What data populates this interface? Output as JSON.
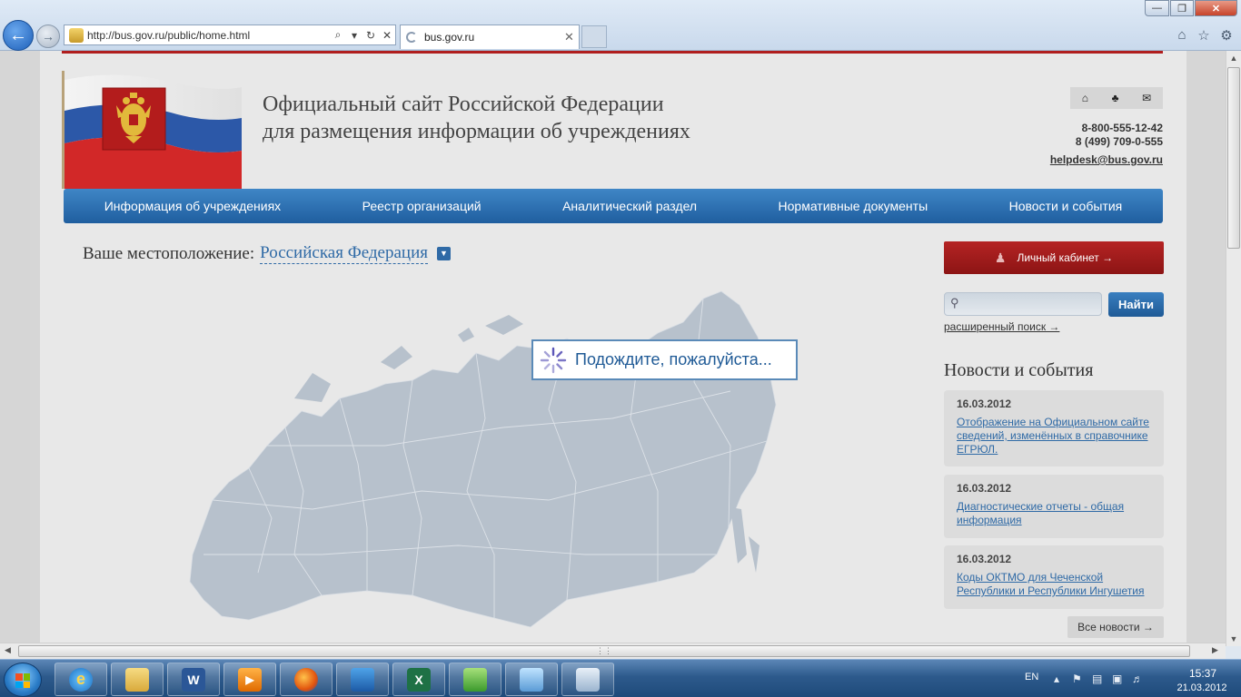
{
  "browser": {
    "url": "http://bus.gov.ru/public/home.html",
    "tab_title": "bus.gov.ru",
    "back_symbol": "←",
    "forward_symbol": "→",
    "address_icons": [
      "⌕",
      "▾",
      "↻",
      "✕"
    ],
    "tab_close": "✕",
    "window_min": "—",
    "window_max": "❐",
    "window_close": "✕",
    "toolbar_icons": [
      "⌂",
      "☆",
      "⚙"
    ]
  },
  "site": {
    "title_line1": "Официальный сайт Российской Федерации",
    "title_line2": "для размещения информации об учреждениях",
    "header_icons": [
      "⌂",
      "♣",
      "✉"
    ],
    "phone1": "8-800-555-12-42",
    "phone2": "8 (499) 709-0-555",
    "email": "helpdesk@bus.gov.ru"
  },
  "nav": {
    "items": [
      "Информация об учреждениях",
      "Реестр организаций",
      "Аналитический раздел",
      "Нормативные документы",
      "Новости и события"
    ]
  },
  "location": {
    "label": "Ваше местоположение:",
    "value": "Российская Федерация",
    "dropdown": "▼"
  },
  "loading": {
    "text": "Подождите, пожалуйста..."
  },
  "sidebar": {
    "cabinet_label": "Личный кабинет →",
    "cabinet_icon": "person-icon",
    "search_placeholder": "",
    "search_button": "Найти",
    "advanced_search": "расширенный поиск →",
    "news_heading": "Новости и события",
    "news": [
      {
        "date": "16.03.2012",
        "text": "Отображение на Официальном сайте сведений, изменённых в справочнике ЕГРЮЛ."
      },
      {
        "date": "16.03.2012",
        "text": "Диагностические отчеты - общая информация"
      },
      {
        "date": "16.03.2012",
        "text": "Коды ОКТМО для Чеченской Республики и Республики Ингушетия"
      }
    ],
    "all_news": "Все новости →"
  },
  "taskbar": {
    "apps": [
      "internet-explorer",
      "explorer-folder",
      "word",
      "media-player",
      "firefox",
      "archive",
      "excel",
      "app-green",
      "image-viewer",
      "remote-desktop"
    ],
    "word_letter": "W",
    "excel_letter": "X",
    "lang": "EN",
    "time": "15:37",
    "date": "21.03.2012"
  },
  "colors": {
    "accent_blue": "#1f5e9f",
    "cabinet_red": "#a01c1c",
    "brand_red_line": "#b01e1e"
  }
}
